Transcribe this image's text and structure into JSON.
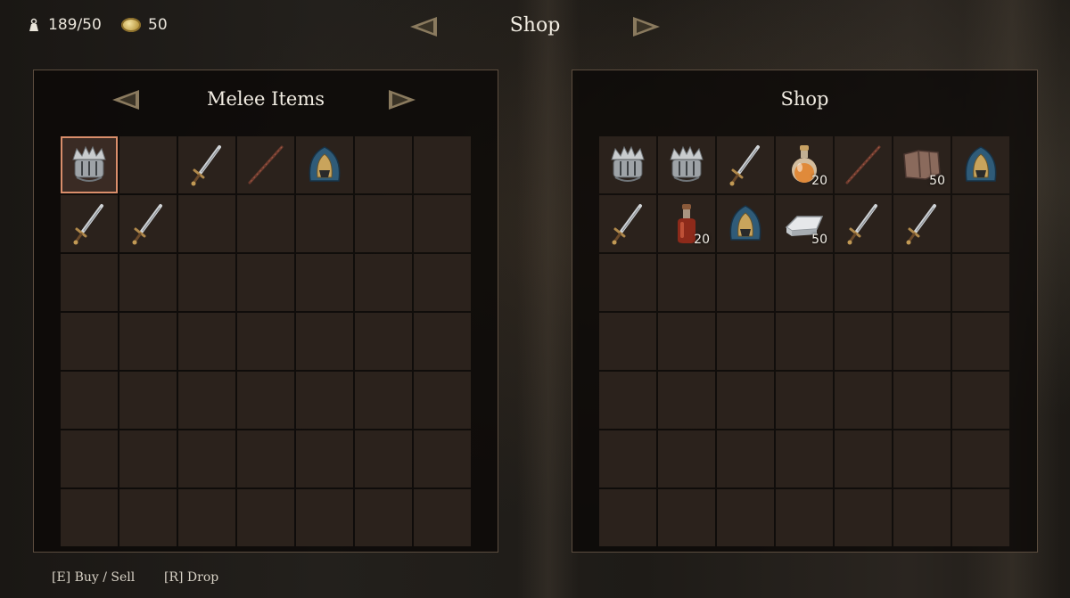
{
  "topbar": {
    "weight": "189/50",
    "gold": "50",
    "title": "Shop"
  },
  "left_panel": {
    "title": "Melee Items",
    "slots": [
      {
        "icon": "crown-helm-icon",
        "qty": "",
        "selected": true
      },
      {
        "icon": "",
        "qty": ""
      },
      {
        "icon": "sword-icon",
        "qty": ""
      },
      {
        "icon": "staff-icon",
        "qty": ""
      },
      {
        "icon": "hood-helmet-icon",
        "qty": ""
      },
      {
        "icon": "",
        "qty": ""
      },
      {
        "icon": "",
        "qty": ""
      },
      {
        "icon": "sword-icon",
        "qty": ""
      },
      {
        "icon": "sword-icon",
        "qty": ""
      }
    ]
  },
  "right_panel": {
    "title": "Shop",
    "slots": [
      {
        "icon": "crown-helm-icon",
        "qty": ""
      },
      {
        "icon": "crown-helm-icon",
        "qty": ""
      },
      {
        "icon": "sword-icon",
        "qty": ""
      },
      {
        "icon": "orange-potion-icon",
        "qty": "20"
      },
      {
        "icon": "staff-icon",
        "qty": ""
      },
      {
        "icon": "leather-icon",
        "qty": "50"
      },
      {
        "icon": "hood-helmet-icon",
        "qty": ""
      },
      {
        "icon": "sword-icon",
        "qty": ""
      },
      {
        "icon": "red-potion-icon",
        "qty": "20"
      },
      {
        "icon": "hood-helmet-icon",
        "qty": ""
      },
      {
        "icon": "iron-ingot-icon",
        "qty": "50"
      },
      {
        "icon": "sword-icon",
        "qty": ""
      },
      {
        "icon": "sword-icon",
        "qty": ""
      }
    ]
  },
  "footer": {
    "buy_sell": "[E] Buy / Sell",
    "drop": "[R] Drop"
  }
}
